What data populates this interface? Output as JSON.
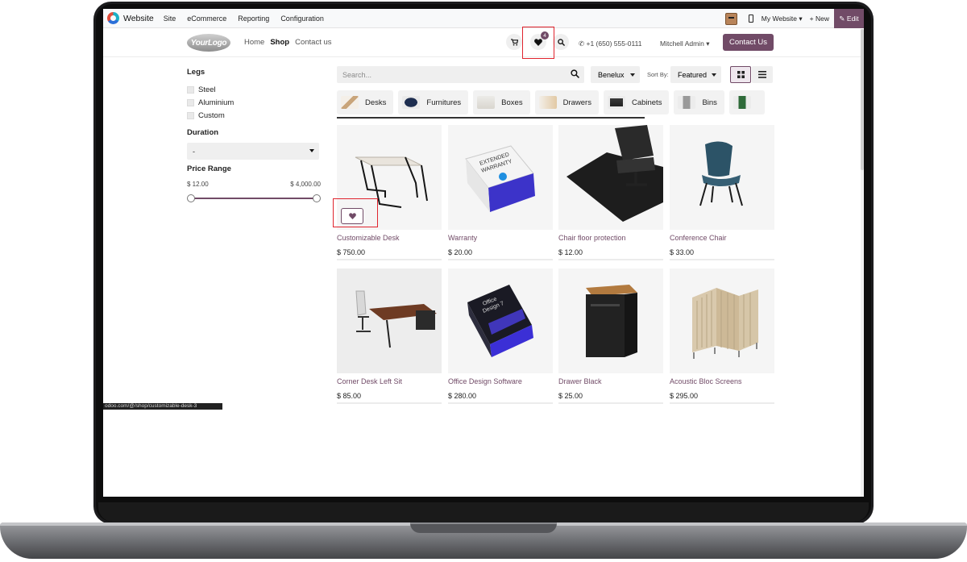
{
  "topbar": {
    "app_name": "Website",
    "menu": [
      "Site",
      "eCommerce",
      "Reporting",
      "Configuration"
    ],
    "website_switch": "My Website ▾",
    "new_label": "+ New",
    "edit_label": "✎ Edit"
  },
  "header": {
    "logo_text": "YourLogo",
    "nav": [
      "Home",
      "Shop",
      "Contact us"
    ],
    "wishlist_count": "4",
    "phone": "+1 (650) 555-0111",
    "user": "Mitchell Admin",
    "contact_button": "Contact Us"
  },
  "filters": {
    "legs_title": "Legs",
    "legs_options": [
      "Steel",
      "Aluminium",
      "Custom"
    ],
    "duration_title": "Duration",
    "duration_value": "-",
    "price_title": "Price Range",
    "price_min": "$ 12.00",
    "price_max": "$ 4,000.00"
  },
  "toolbar": {
    "search_placeholder": "Search...",
    "pricelist": "Benelux",
    "sort_label": "Sort By:",
    "sort_value": "Featured"
  },
  "categories": [
    "Desks",
    "Furnitures",
    "Boxes",
    "Drawers",
    "Cabinets",
    "Bins",
    ""
  ],
  "products": [
    {
      "name": "Customizable Desk",
      "price": "$ 750.00"
    },
    {
      "name": "Warranty",
      "price": "$ 20.00"
    },
    {
      "name": "Chair floor protection",
      "price": "$ 12.00"
    },
    {
      "name": "Conference Chair",
      "price": "$ 33.00"
    },
    {
      "name": "Corner Desk Left Sit",
      "price": "$ 85.00"
    },
    {
      "name": "Office Design Software",
      "price": "$ 280.00"
    },
    {
      "name": "Drawer Black",
      "price": "$ 25.00"
    },
    {
      "name": "Acoustic Bloc Screens",
      "price": "$ 295.00"
    }
  ],
  "status_url": "odoo.com/@/shop/customizable-desk-3",
  "colors": {
    "brand": "#714b67",
    "highlight": "#e0242e"
  },
  "icons": [
    "cart-icon",
    "heart-icon",
    "search-icon",
    "phone-icon",
    "grid-view-icon",
    "list-view-icon",
    "mobile-preview-icon",
    "pencil-icon"
  ]
}
